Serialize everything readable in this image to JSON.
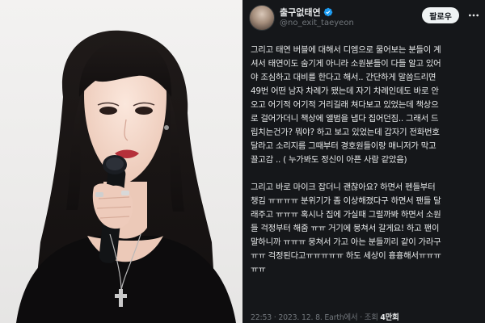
{
  "tweet": {
    "author": {
      "display_name": "출구없태연",
      "handle": "@no_exit_taeyeon",
      "verified_color": "#1d9bf0"
    },
    "follow_label": "팔로우",
    "body": {
      "para1": [
        "그리고 태연 버블에 대해서 디엠으로 물어보는 분들이 계",
        "셔서 태연이도 숨기게 아니라 소원분들이 다들 알고 있어",
        "야 조심하고 대비를 한다고 해서.. 간단하게 말씀드리면",
        "49번 어떤 남자 차례가 됐는데 자기 차례인데도 바로 안",
        "오고 어기적 어기적 거리길래 쳐다보고 있었는데 책상으",
        "로 걸어가더니 책상에 앨범을 냅다 집어던짐.. 그래서 드",
        "립치는건가? 뭐야? 하고 보고 있었는데 갑자기 전화번호",
        "달라고 소리지름 그때부터 경호원들이랑 매니저가 막고",
        "끌고감 .. ( 누가봐도 정신이 아픈 사람 같았음)"
      ],
      "para2": [
        "그리고 바로 마이크 잡더니 괜찮아요? 하면서 펜들부터",
        "챙김 ㅠㅠㅠㅠ 분위기가 좀 이상해졌다구 하면서 팬들 달",
        "래주고 ㅠㅠㅠ 혹시나 집에 가실때 그럴까봐 하면서 소원",
        "들 걱정부터 해줌 ㅠㅠ 거기에 뭉쳐서 갈게요! 하고 팬이",
        "말하니까 ㅠㅠㅠ 뭉쳐서 가고 아는 분들끼리 같이 가라구",
        "ㅠㅠ 걱정된다고ㅠㅠㅠㅠㅠ 하도 세상이 흉흉해서ㅠㅠㅠ",
        "ㅠㅠ"
      ]
    },
    "meta": {
      "time": "22:53",
      "date": "2023. 12. 8.",
      "source": "Earth에서",
      "views_label": "조회",
      "views_count": "4만회"
    }
  },
  "icons": {
    "more": "more-horizontal-icon",
    "verified": "verified-badge-icon"
  },
  "colors": {
    "tweet_background": "#15171a",
    "text_primary": "#e7e9ea",
    "text_secondary": "#71767b",
    "follow_button_bg": "#eff3f4"
  }
}
